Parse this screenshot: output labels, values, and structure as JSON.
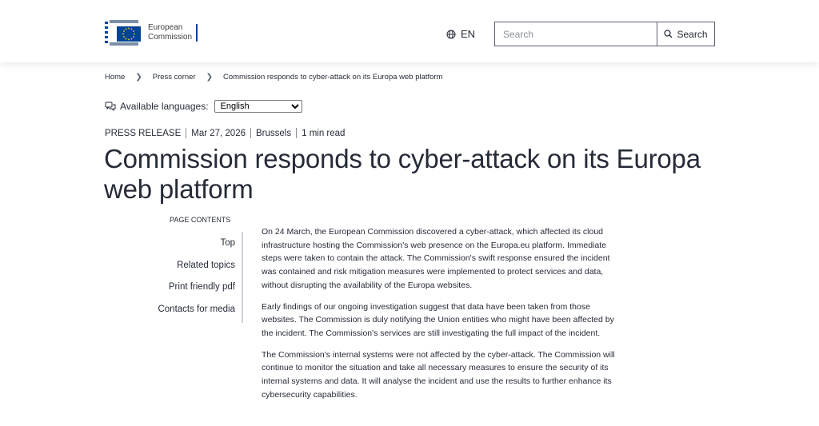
{
  "header": {
    "logo_line1": "European",
    "logo_line2": "Commission",
    "language": "EN",
    "search_placeholder": "Search",
    "search_button": "Search"
  },
  "breadcrumb": [
    "Home",
    "Press corner",
    "Commission responds to cyber-attack on its Europa web platform"
  ],
  "available_languages": {
    "label": "Available languages:",
    "selected": "English"
  },
  "meta": {
    "type": "PRESS RELEASE",
    "date": "Mar 27, 2026",
    "location": "Brussels",
    "read_time": "1 min read"
  },
  "title": "Commission responds to cyber-attack on its Europa web platform",
  "page_contents": {
    "heading": "PAGE CONTENTS",
    "items": [
      "Top",
      "Related topics",
      "Print friendly pdf",
      "Contacts for media"
    ]
  },
  "article": {
    "paragraphs": [
      "On 24 March, the European Commission discovered a cyber-attack, which affected its cloud infrastructure hosting the Commission's web presence on the Europa.eu platform. Immediate steps were taken to contain the attack. The Commission's swift response ensured the incident was contained and risk mitigation measures were implemented to protect services and data, without disrupting the availability of the Europa websites.",
      "Early findings of our ongoing investigation suggest that data have been taken from those websites. The Commission is duly notifying the Union entities who might have been affected by the incident. The Commission's services are still investigating the full impact of the incident.",
      "The Commission's internal systems were not affected by the cyber-attack. The Commission will continue to monitor the situation and take all necessary measures to ensure the security of its internal systems and data. It will analyse the incident and use the results to further enhance its cybersecurity capabilities."
    ]
  },
  "colors": {
    "eu_blue": "#004494",
    "eu_yellow": "#ffd617",
    "text": "#262b38"
  }
}
